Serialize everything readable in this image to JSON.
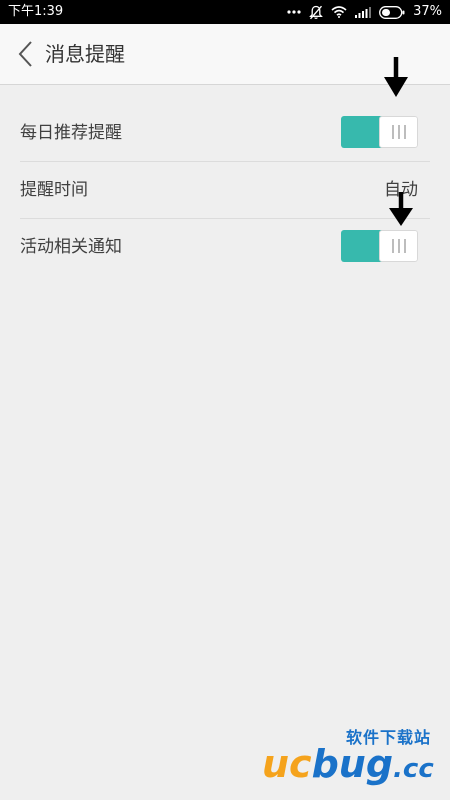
{
  "status_bar": {
    "time": "下午1:39",
    "battery_percent": "37%",
    "icons": [
      "more-dots-icon",
      "bell-muted-icon",
      "wifi-icon",
      "signal-icon",
      "battery-icon"
    ]
  },
  "header": {
    "title": "消息提醒",
    "back_icon": "chevron-left-icon"
  },
  "settings": {
    "items": [
      {
        "label": "每日推荐提醒",
        "control": "toggle",
        "enabled": true
      },
      {
        "label": "提醒时间",
        "control": "value",
        "value": "自动"
      },
      {
        "label": "活动相关通知",
        "control": "toggle",
        "enabled": true
      }
    ]
  },
  "colors": {
    "toggle_on": "#37b9ad",
    "background": "#efefef",
    "text": "#404040"
  },
  "watermark": {
    "site_label": "软件下载站",
    "brand_uc": "uc",
    "brand_bug": "bug",
    "brand_cc": ".cc"
  }
}
